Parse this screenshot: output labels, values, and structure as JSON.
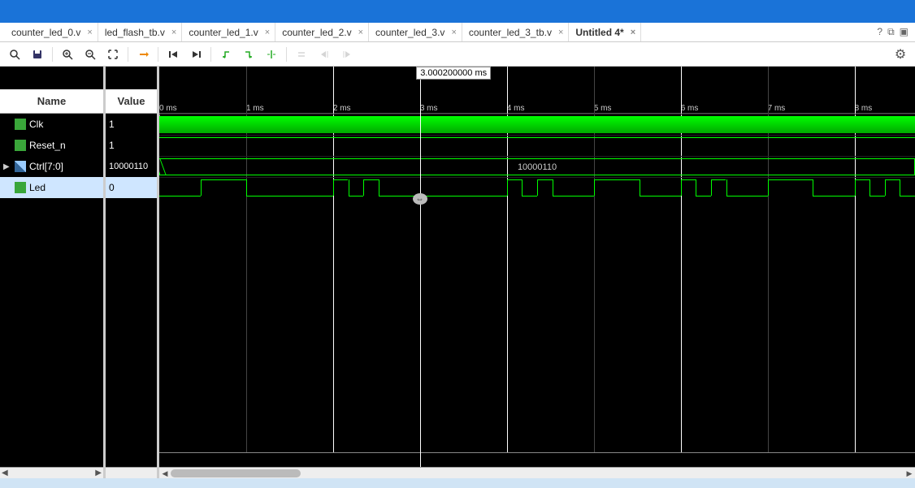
{
  "tabs": [
    {
      "label": "counter_led_0.v",
      "active": false
    },
    {
      "label": "led_flash_tb.v",
      "active": false
    },
    {
      "label": "counter_led_1.v",
      "active": false
    },
    {
      "label": "counter_led_2.v",
      "active": false
    },
    {
      "label": "counter_led_3.v",
      "active": false
    },
    {
      "label": "counter_led_3_tb.v",
      "active": false
    },
    {
      "label": "Untitled 4*",
      "active": true
    }
  ],
  "tab_right_icons": [
    "?",
    "⧉",
    "▣"
  ],
  "columns": {
    "name": "Name",
    "value": "Value"
  },
  "signals": [
    {
      "name": "Clk",
      "value": "1",
      "icon": "clk",
      "expandable": false,
      "selected": false
    },
    {
      "name": "Reset_n",
      "value": "1",
      "icon": "reg",
      "expandable": false,
      "selected": false
    },
    {
      "name": "Ctrl[7:0]",
      "value": "10000110",
      "icon": "bus",
      "expandable": true,
      "selected": false
    },
    {
      "name": "Led",
      "value": "0",
      "icon": "led",
      "expandable": false,
      "selected": true
    }
  ],
  "cursor": {
    "label": "3.000200000 ms",
    "position_pct": 34.5
  },
  "ruler_ticks": [
    "0 ms",
    "1 ms",
    "2 ms",
    "3 ms",
    "4 ms",
    "5 ms",
    "6 ms",
    "7 ms",
    "8 ms"
  ],
  "bus_value": "10000110",
  "toolbar_icons": [
    "search",
    "save",
    "zoom-in",
    "zoom-out",
    "zoom-fit",
    "|",
    "marker-prev",
    "restart",
    "run",
    "|",
    "step-left",
    "step-right",
    "add-marker",
    "|",
    "swap-a",
    "swap-b",
    "swap-c"
  ],
  "settings_icon": "⚙"
}
